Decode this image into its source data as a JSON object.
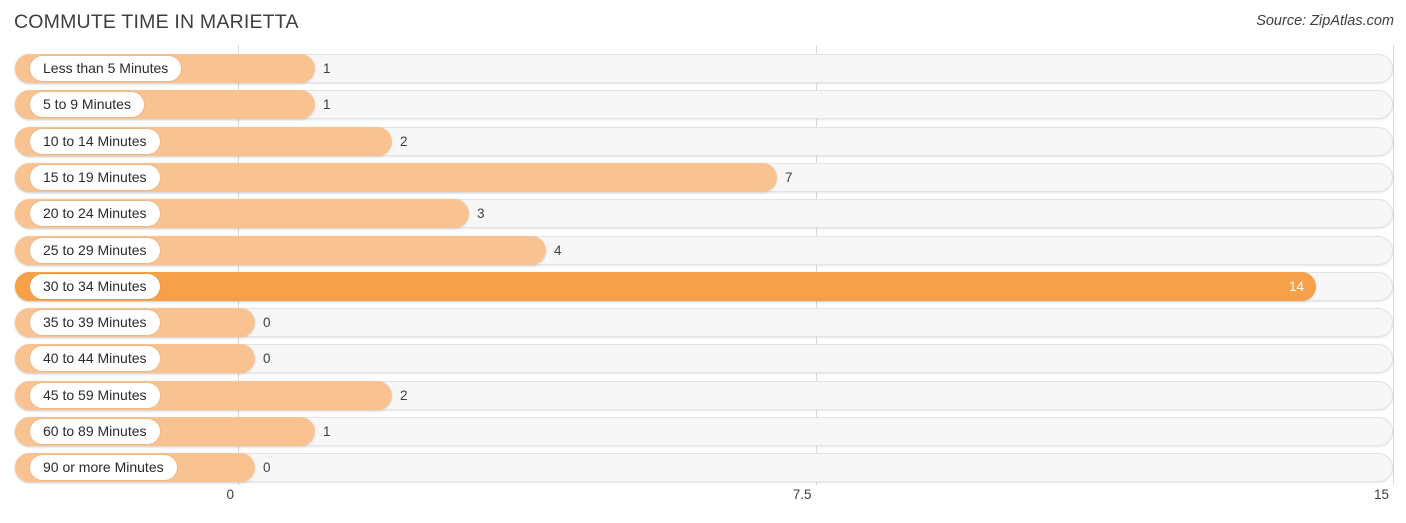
{
  "header": {
    "title": "COMMUTE TIME IN MARIETTA",
    "source": "Source: ZipAtlas.com"
  },
  "colors": {
    "bar": "#f8c391",
    "bar_highlight": "#f6a14a",
    "track": "#f7f7f7",
    "grid": "#d9d9d9",
    "text": "#3c4043"
  },
  "chart_data": {
    "type": "bar",
    "orientation": "horizontal",
    "title": "COMMUTE TIME IN MARIETTA",
    "xlabel": "",
    "ylabel": "",
    "xlim": [
      0,
      15
    ],
    "grid": true,
    "legend": null,
    "ticks": [
      "0",
      "7.5",
      "15"
    ],
    "tick_values": [
      0,
      7.5,
      15
    ],
    "categories": [
      "Less than 5 Minutes",
      "5 to 9 Minutes",
      "10 to 14 Minutes",
      "15 to 19 Minutes",
      "20 to 24 Minutes",
      "25 to 29 Minutes",
      "30 to 34 Minutes",
      "35 to 39 Minutes",
      "40 to 44 Minutes",
      "45 to 59 Minutes",
      "60 to 89 Minutes",
      "90 or more Minutes"
    ],
    "values": [
      1,
      1,
      2,
      7,
      3,
      4,
      14,
      0,
      0,
      2,
      1,
      0
    ],
    "value_labels": [
      "1",
      "1",
      "2",
      "7",
      "3",
      "4",
      "14",
      "0",
      "0",
      "2",
      "1",
      "0"
    ],
    "highlight_index": 6
  }
}
